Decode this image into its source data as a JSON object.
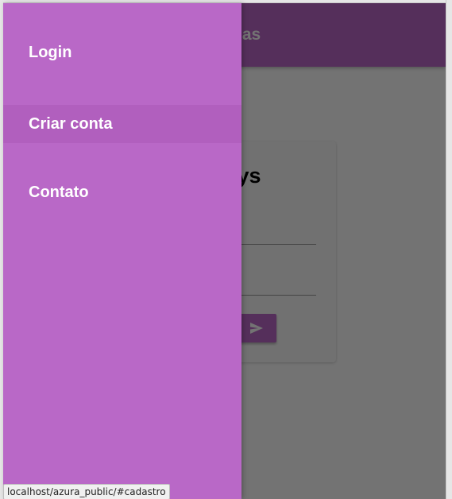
{
  "appbar": {
    "title": "istemas"
  },
  "card": {
    "title": "rasys"
  },
  "drawer": {
    "items": [
      {
        "label": "Login"
      },
      {
        "label": "Criar conta"
      },
      {
        "label": "Contato"
      }
    ]
  },
  "status": {
    "url": "localhost/azura_public/#cadastro"
  },
  "colors": {
    "primary": "#bd68c9",
    "drawer": "#b968c7",
    "drawer_active": "#b15fbe"
  },
  "icons": {
    "send": "send-icon"
  }
}
